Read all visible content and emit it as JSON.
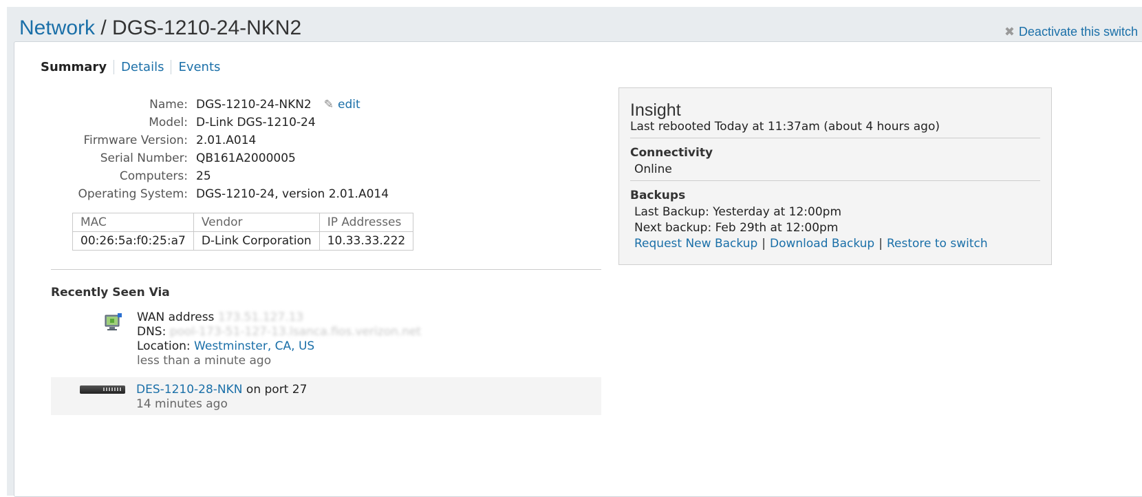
{
  "header": {
    "breadcrumb": "Network",
    "separator": " / ",
    "title": "DGS-1210-24-NKN2",
    "deactivate_label": "Deactivate this switch"
  },
  "tabs": [
    "Summary",
    "Details",
    "Events"
  ],
  "info": {
    "name_label": "Name:",
    "name": "DGS-1210-24-NKN2",
    "edit_label": "edit",
    "model_label": "Model:",
    "model": "D-Link DGS-1210-24",
    "firmware_label": "Firmware Version:",
    "firmware": "2.01.A014",
    "serial_label": "Serial Number:",
    "serial": "QB161A2000005",
    "computers_label": "Computers:",
    "computers": "25",
    "os_label": "Operating System:",
    "os": "DGS-1210-24, version 2.01.A014"
  },
  "interfaces": {
    "headers": [
      "MAC",
      "Vendor",
      "IP Addresses"
    ],
    "rows": [
      [
        "00:26:5a:f0:25:a7",
        "D-Link Corporation",
        "10.33.33.222"
      ]
    ]
  },
  "recently_seen": {
    "heading": "Recently Seen Via",
    "wan": {
      "wan_label": "WAN address",
      "wan_value": "173.51.127.13",
      "dns_label": "DNS:",
      "dns_value": "pool-173-51-127-13.lsanca.fios.verizon.net",
      "location_label": "Location:",
      "location_value": "Westminster, CA, US",
      "time": "less than a minute ago"
    },
    "switch": {
      "name": "DES-1210-28-NKN",
      "port_text": "on port 27",
      "time": "14 minutes ago"
    }
  },
  "insight": {
    "title": "Insight",
    "reboot": "Last rebooted Today at 11:37am (about 4 hours ago)",
    "connectivity_heading": "Connectivity",
    "connectivity_status": "Online",
    "backups_heading": "Backups",
    "last_backup": "Last Backup: Yesterday at 12:00pm",
    "next_backup": "Next backup: Feb 29th at 12:00pm",
    "links": [
      "Request New Backup",
      "Download Backup",
      "Restore to switch"
    ],
    "link_separator": "|"
  }
}
